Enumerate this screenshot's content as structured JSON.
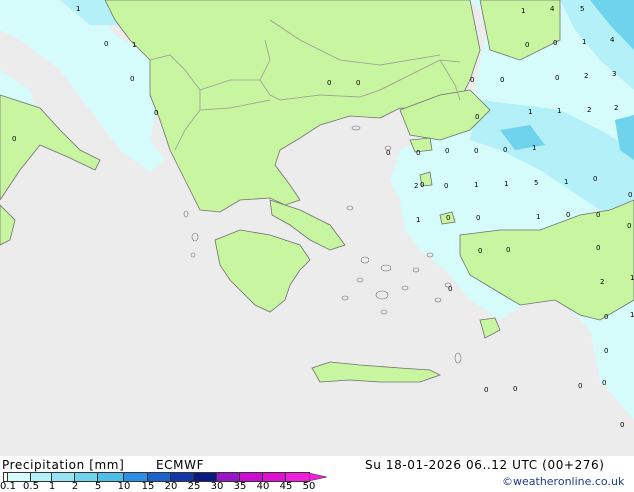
{
  "header": {
    "title": "Precipitation [mm]",
    "model": "ECMWF",
    "datetime": "Su 18-01-2026 06..12 UTC (00+276)",
    "credit": "©weatheronline.co.uk"
  },
  "legend": {
    "ticks": [
      "0.1",
      "0.5",
      "1",
      "2",
      "5",
      "10",
      "15",
      "20",
      "25",
      "30",
      "35",
      "40",
      "45",
      "50"
    ],
    "colors": [
      "#ffffff",
      "#d6fbfb",
      "#b4f0f8",
      "#95e3f3",
      "#6fd3ed",
      "#4fbfe8",
      "#2f8fe0",
      "#1c62c8",
      "#1238a8",
      "#0a1a80",
      "#9a14c8",
      "#c80fd0",
      "#e010d0",
      "#ee20d8"
    ]
  },
  "map_colors": {
    "sea": "#ececec",
    "land": "#c8f5a0",
    "border": "#9a9a9a",
    "coast": "#707070",
    "precip_light": "#d6fbfb",
    "precip_mid": "#b4f0f8",
    "precip_heavy": "#6fd3ed"
  },
  "map_labels": [
    {
      "text": "1"
    },
    {
      "text": "0"
    },
    {
      "text": "1"
    },
    {
      "text": "0"
    },
    {
      "text": "0"
    },
    {
      "text": "0"
    },
    {
      "text": "0"
    },
    {
      "text": "1"
    },
    {
      "text": "4"
    },
    {
      "text": "5"
    },
    {
      "text": "0"
    },
    {
      "text": "0"
    },
    {
      "text": "1"
    },
    {
      "text": "4"
    },
    {
      "text": "0"
    },
    {
      "text": "0"
    },
    {
      "text": "2"
    },
    {
      "text": "3"
    },
    {
      "text": "0"
    },
    {
      "text": "1"
    },
    {
      "text": "1"
    },
    {
      "text": "2"
    },
    {
      "text": "2"
    },
    {
      "text": "0"
    },
    {
      "text": "0"
    },
    {
      "text": "0"
    },
    {
      "text": "0"
    },
    {
      "text": "0"
    },
    {
      "text": "1"
    },
    {
      "text": "2"
    },
    {
      "text": "0"
    },
    {
      "text": "1"
    },
    {
      "text": "1"
    },
    {
      "text": "5"
    },
    {
      "text": "1"
    },
    {
      "text": "0"
    },
    {
      "text": "1"
    },
    {
      "text": "0"
    },
    {
      "text": "0"
    },
    {
      "text": "1"
    },
    {
      "text": "0"
    },
    {
      "text": "0"
    },
    {
      "text": "0"
    },
    {
      "text": "0"
    },
    {
      "text": "0"
    },
    {
      "text": "0"
    },
    {
      "text": "2"
    },
    {
      "text": "1"
    },
    {
      "text": "0"
    },
    {
      "text": "0"
    },
    {
      "text": "0"
    },
    {
      "text": "0"
    },
    {
      "text": "0"
    },
    {
      "text": "0"
    },
    {
      "text": "0"
    },
    {
      "text": "0"
    },
    {
      "text": "0"
    },
    {
      "text": "0"
    },
    {
      "text": "0"
    },
    {
      "text": "1"
    },
    {
      "text": "0"
    }
  ]
}
